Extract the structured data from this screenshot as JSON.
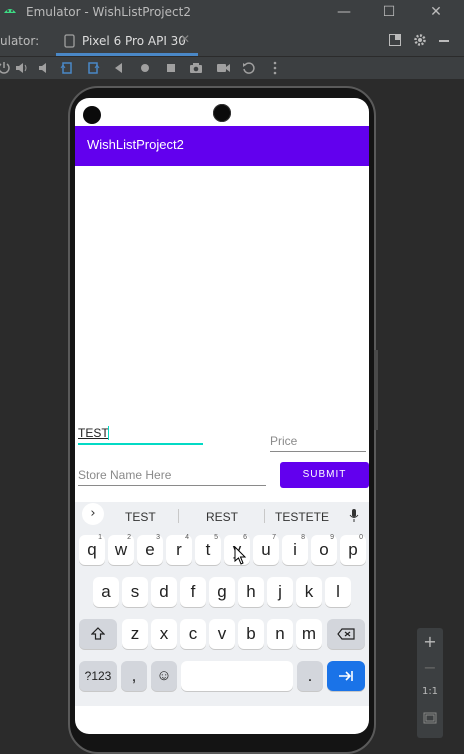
{
  "window": {
    "title": "Emulator - WishListProject2",
    "controls": {
      "minimize": "—",
      "maximize": "☐",
      "close": "✕"
    }
  },
  "tabbar": {
    "label": "ulator:",
    "tab_title": "Pixel 6 Pro API 30",
    "tab_close": "✕",
    "right_icons": [
      "restore-icon",
      "gear-icon",
      "minimize-panel-icon"
    ]
  },
  "toolbar": {
    "icons": [
      "power-icon",
      "volume-up-icon",
      "volume-down-icon",
      "rotate-left-icon",
      "rotate-right-icon",
      "back-icon",
      "home-icon",
      "overview-icon",
      "camera-icon",
      "video-icon",
      "replay-icon",
      "more-icon"
    ]
  },
  "app": {
    "title": "WishListProject2",
    "item_field": {
      "value": "TEST"
    },
    "price_field": {
      "placeholder": "Price"
    },
    "store_field": {
      "placeholder": "Store Name Here"
    },
    "submit_label": "SUBMIT",
    "accent": "#6200ee",
    "cursor_color": "#03dac5"
  },
  "keyboard": {
    "suggestions": [
      "TEST",
      "REST",
      "TESTETE"
    ],
    "row1": [
      {
        "key": "q",
        "hint": "1"
      },
      {
        "key": "w",
        "hint": "2"
      },
      {
        "key": "e",
        "hint": "3"
      },
      {
        "key": "r",
        "hint": "4"
      },
      {
        "key": "t",
        "hint": "5"
      },
      {
        "key": "y",
        "hint": "6"
      },
      {
        "key": "u",
        "hint": "7"
      },
      {
        "key": "i",
        "hint": "8"
      },
      {
        "key": "o",
        "hint": "9"
      },
      {
        "key": "p",
        "hint": "0"
      }
    ],
    "row2": [
      "a",
      "s",
      "d",
      "f",
      "g",
      "h",
      "j",
      "k",
      "l"
    ],
    "row3": [
      "z",
      "x",
      "c",
      "v",
      "b",
      "n",
      "m"
    ],
    "symbols_label": "?123",
    "comma_label": ",",
    "period_label": "."
  },
  "zoom": {
    "zoom_in": "+",
    "zoom_out": "−",
    "actual_size": "1:1"
  }
}
